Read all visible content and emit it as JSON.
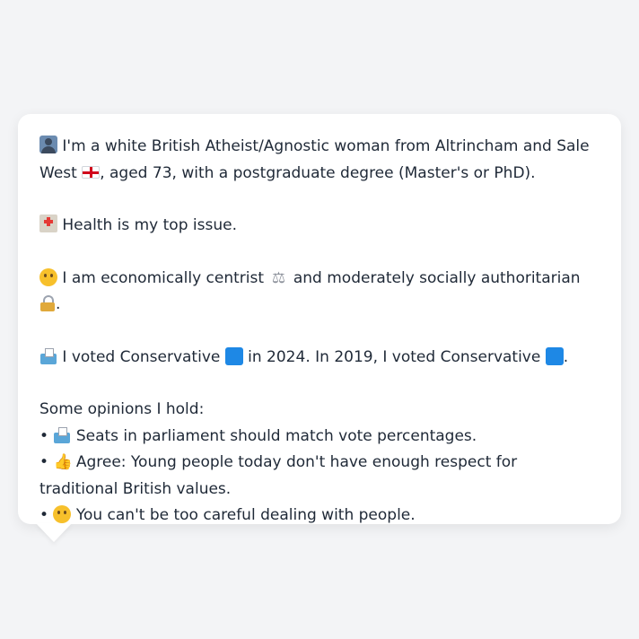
{
  "profile": {
    "line1_text_a": " I'm a white British Atheist/Agnostic woman from Altrincham and Sale West ",
    "line1_text_b": ", aged 73, with a postgraduate degree (Master's or PhD).",
    "health_text": " Health is my top issue.",
    "ideology_text_a": " I am economically centrist ",
    "ideology_text_b": " and moderately socially authoritarian ",
    "ideology_text_c": ".",
    "vote_text_a": " I voted Conservative ",
    "vote_text_b": " in 2024. In 2019, I voted Conservative ",
    "vote_text_c": ".",
    "opinions_heading": "Some opinions I hold:",
    "opinions": [
      {
        "bullet": "• ",
        "text": " Seats in parliament should match vote percentages."
      },
      {
        "bullet": "• ",
        "text": " Agree: Young people today don't have enough respect for traditional British values."
      },
      {
        "bullet": "• ",
        "text": " You can't be too careful dealing with people."
      }
    ]
  },
  "icons": {
    "person": "person-silhouette-icon",
    "flag": "england-flag-icon",
    "hospital": "hospital-icon",
    "thinking": "thinking-face-icon",
    "scales": "balance-scale-icon",
    "lock": "lock-icon",
    "ballot": "ballot-box-icon",
    "party_color": "#1e88e5",
    "thumbs_up": "thumbs-up-icon",
    "raised_eyebrow": "raised-eyebrow-face-icon"
  }
}
